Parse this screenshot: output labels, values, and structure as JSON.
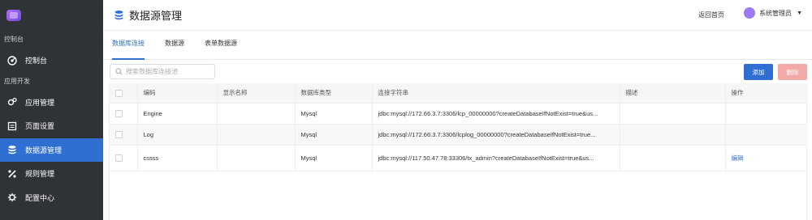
{
  "sidebar": {
    "groups": [
      {
        "title": "控制台",
        "items": [
          {
            "label": "控制台",
            "icon": "dashboard-icon"
          }
        ]
      },
      {
        "title": "应用开发",
        "items": [
          {
            "label": "应用管理",
            "icon": "gears-icon"
          },
          {
            "label": "页面设置",
            "icon": "page-icon"
          },
          {
            "label": "数据源管理",
            "icon": "database-icon",
            "active": true
          },
          {
            "label": "规则管理",
            "icon": "rules-icon"
          },
          {
            "label": "配置中心",
            "icon": "config-icon"
          }
        ]
      }
    ]
  },
  "header": {
    "title": "数据源管理",
    "back_link": "返回首页",
    "user_name": "系统管理员"
  },
  "tabs": [
    "数据库连接",
    "数据源",
    "表单数据源"
  ],
  "toolbar": {
    "search_placeholder": "搜索数据库连接池",
    "add_label": "添加",
    "delete_label": "删除"
  },
  "table": {
    "columns": [
      "编码",
      "显示名称",
      "数据库类型",
      "连接字符串",
      "描述",
      "操作"
    ],
    "rows": [
      {
        "code": "Engine",
        "display_name": "",
        "db_type": "Mysql",
        "conn": "jdbc:mysql://172.66.3.7:3306/lcp_00000000?createDatabaseIfNotExist=true&us...",
        "desc": "",
        "action": ""
      },
      {
        "code": "Log",
        "display_name": "",
        "db_type": "Mysql",
        "conn": "jdbc:mysql://172.66.3.7:3306/lcplog_00000000?createDatabaseIfNotExist=true...",
        "desc": "",
        "action": ""
      },
      {
        "code": "cssss",
        "display_name": "",
        "db_type": "Mysql",
        "conn": "jdbc:mysql://117.50.47.78:33306/tx_admin?createDatabaseIfNotExist=true&us...",
        "desc": "",
        "action": "编辑"
      }
    ]
  },
  "colors": {
    "primary": "#2f6fd1",
    "sidebar_bg": "#2f3237",
    "danger_disabled": "#f4a9a9",
    "avatar": "#9a7cf0"
  }
}
